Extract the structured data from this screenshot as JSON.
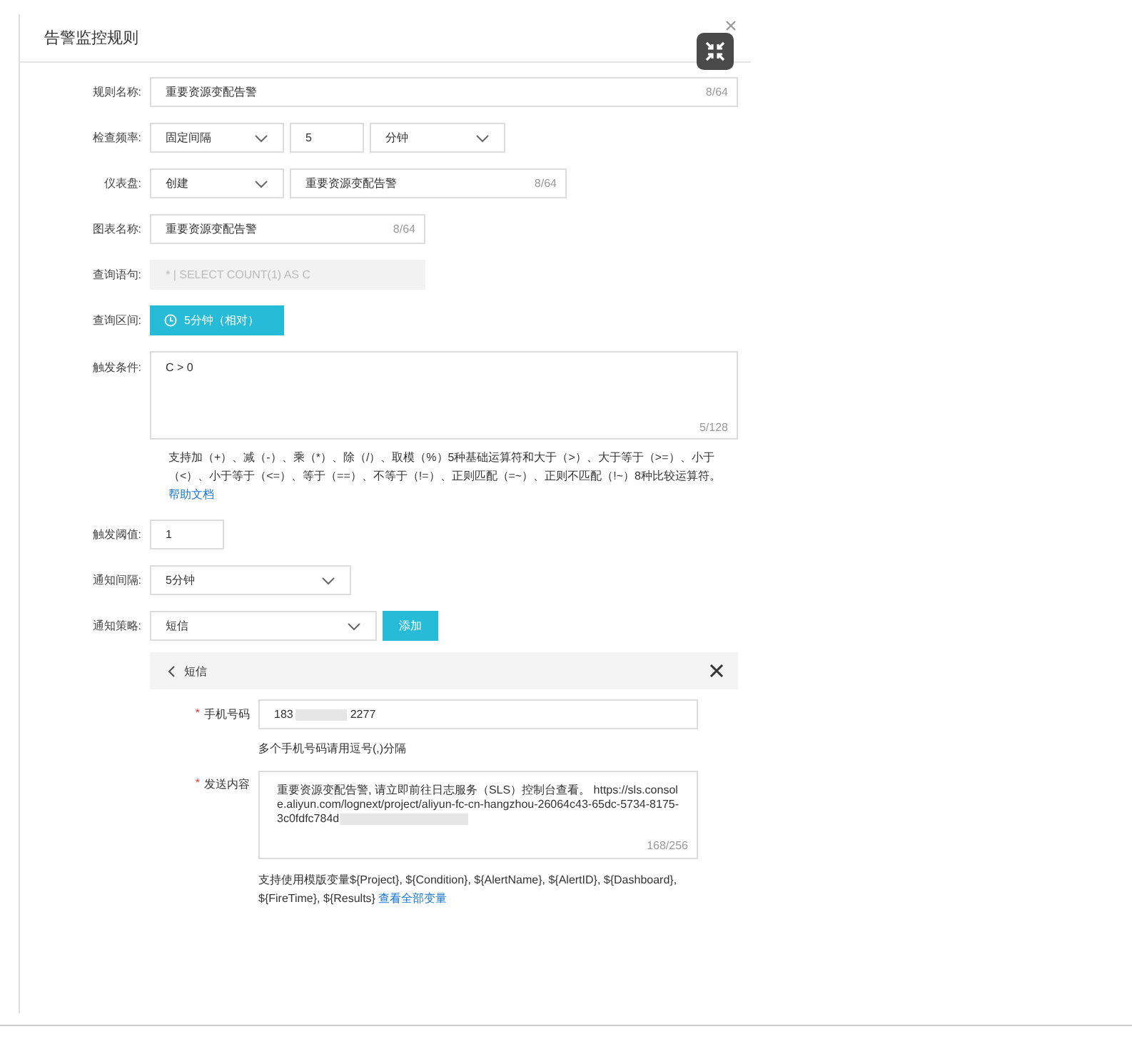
{
  "dialog": {
    "title": "告警监控规则"
  },
  "rule_name": {
    "label": "规则名称:",
    "value": "重要资源变配告警",
    "counter": "8/64"
  },
  "check_frequency": {
    "label": "检查频率:",
    "mode": "固定间隔",
    "amount": "5",
    "unit": "分钟"
  },
  "dashboard": {
    "label": "仪表盘:",
    "mode": "创建",
    "value": "重要资源变配告警",
    "counter": "8/64"
  },
  "chart_name": {
    "label": "图表名称:",
    "value": "重要资源变配告警",
    "counter": "8/64"
  },
  "query": {
    "label": "查询语句:",
    "placeholder": "* | SELECT COUNT(1) AS C",
    "disabled": true
  },
  "query_range": {
    "label": "查询区间:",
    "button": "5分钟（相对）"
  },
  "trigger": {
    "label": "触发条件:",
    "value": "C > 0",
    "counter": "5/128",
    "help": "支持加（+）、减（-）、乘（*）、除（/）、取模（%）5种基础运算符和大于（>）、大于等于（>=）、小于（<）、小于等于（<=）、等于（==）、不等于（!=）、正则匹配（=~）、正则不匹配（!~）8种比较运算符。",
    "help_link": "帮助文档"
  },
  "threshold": {
    "label": "触发阈值:",
    "value": "1"
  },
  "notify_interval": {
    "label": "通知间隔:",
    "value": "5分钟"
  },
  "notify_policy": {
    "label": "通知策略:",
    "value": "短信",
    "add_button": "添加"
  },
  "policy_panel": {
    "title": "短信",
    "phone": {
      "required_mark": "*",
      "label": "手机号码",
      "value_start": "183",
      "value_end": "2277",
      "hint": "多个手机号码请用逗号(,)分隔"
    },
    "content": {
      "required_mark": "*",
      "label": "发送内容",
      "value": "重要资源变配告警, 请立即前往日志服务（SLS）控制台查看。 https://sls.console.aliyun.com/lognext/project/aliyun-fc-cn-hangzhou-26064c43-65dc-5734-8175-3c0fdfc784d",
      "counter": "168/256",
      "hint": "支持使用模版变量${Project}, ${Condition}, ${AlertName}, ${AlertID}, ${Dashboard}, ${FireTime}, ${Results}",
      "hint_link": "查看全部变量"
    }
  }
}
